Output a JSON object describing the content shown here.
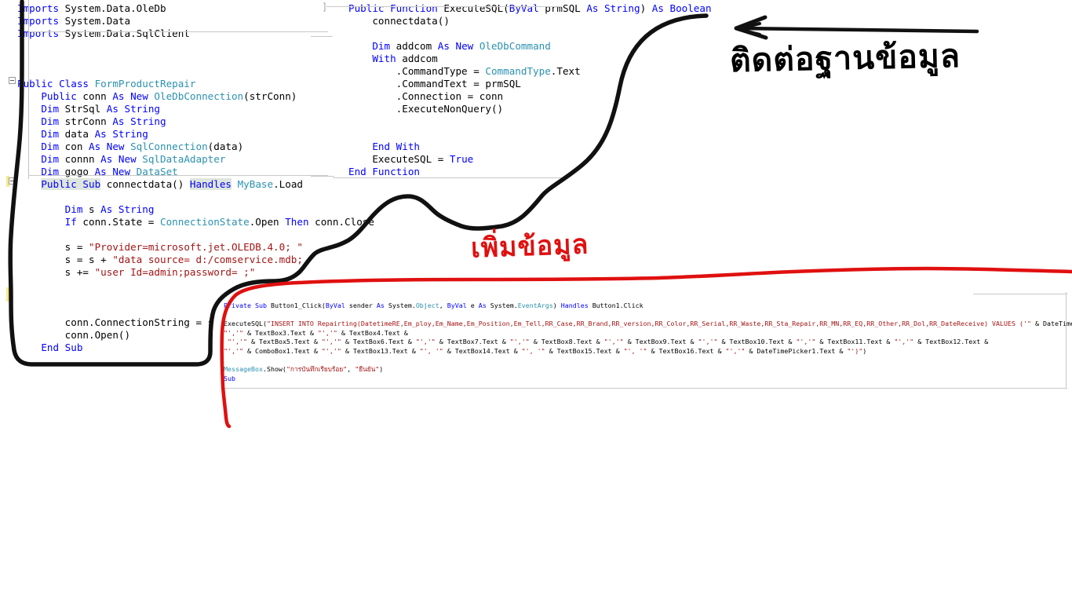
{
  "app": {
    "kind": "vb-net-code-editor-screenshot",
    "colors": {
      "keyword": "#0000FF",
      "type": "#2B91AF",
      "string": "#A31515",
      "plain": "#000000",
      "selection": "#DFE6DD",
      "black_ink": "#000000",
      "red_ink": "#E01010",
      "background": "#FFFFFF",
      "change_bar": "#F7E98A"
    }
  },
  "panes": {
    "top_left": {
      "name": "imports-and-class-declaration-pane",
      "lines": [
        [
          {
            "t": "Imports ",
            "c": "kw"
          },
          {
            "t": "System.Data.OleDb",
            "c": "pl"
          }
        ],
        [
          {
            "t": "Imports ",
            "c": "kw"
          },
          {
            "t": "System.Data",
            "c": "pl"
          }
        ],
        [
          {
            "t": "Imports ",
            "c": "kw"
          },
          {
            "t": "System.Data.SqlClient",
            "c": "pl"
          }
        ],
        [],
        [],
        [],
        [
          {
            "t": "Public Class ",
            "c": "kw"
          },
          {
            "t": "FormProductRepair",
            "c": "ty"
          }
        ],
        [
          {
            "t": "    Public ",
            "c": "kw"
          },
          {
            "t": "conn ",
            "c": "pl"
          },
          {
            "t": "As New ",
            "c": "kw"
          },
          {
            "t": "OleDbConnection",
            "c": "ty"
          },
          {
            "t": "(strConn)",
            "c": "pl"
          }
        ],
        [
          {
            "t": "    Dim ",
            "c": "kw"
          },
          {
            "t": "StrSql ",
            "c": "pl"
          },
          {
            "t": "As String",
            "c": "kw"
          }
        ],
        [
          {
            "t": "    Dim ",
            "c": "kw"
          },
          {
            "t": "strConn ",
            "c": "pl"
          },
          {
            "t": "As String",
            "c": "kw"
          }
        ],
        [
          {
            "t": "    Dim ",
            "c": "kw"
          },
          {
            "t": "data ",
            "c": "pl"
          },
          {
            "t": "As String",
            "c": "kw"
          }
        ],
        [
          {
            "t": "    Dim ",
            "c": "kw"
          },
          {
            "t": "con ",
            "c": "pl"
          },
          {
            "t": "As New ",
            "c": "kw"
          },
          {
            "t": "SqlConnection",
            "c": "ty"
          },
          {
            "t": "(data)",
            "c": "pl"
          }
        ],
        [
          {
            "t": "    Dim ",
            "c": "kw"
          },
          {
            "t": "connn ",
            "c": "pl"
          },
          {
            "t": "As New ",
            "c": "kw"
          },
          {
            "t": "SqlDataAdapter",
            "c": "ty"
          }
        ],
        [
          {
            "t": "    Dim ",
            "c": "kw"
          },
          {
            "t": "gogo ",
            "c": "pl"
          },
          {
            "t": "As New ",
            "c": "kw"
          },
          {
            "t": "DataSet",
            "c": "ty"
          }
        ],
        [
          {
            "t": "    ",
            "c": "pl"
          },
          {
            "t": "Public Sub",
            "c": "kw sel"
          },
          {
            "t": " connectdata() ",
            "c": "pl"
          },
          {
            "t": "Handles",
            "c": "kw sel"
          },
          {
            "t": " ",
            "c": "pl"
          },
          {
            "t": "MyBase",
            "c": "ty"
          },
          {
            "t": ".Load",
            "c": "pl"
          }
        ],
        [],
        [
          {
            "t": "        Dim ",
            "c": "kw"
          },
          {
            "t": "s ",
            "c": "pl"
          },
          {
            "t": "As String",
            "c": "kw"
          }
        ],
        [
          {
            "t": "        If ",
            "c": "kw"
          },
          {
            "t": "conn.State = ",
            "c": "pl"
          },
          {
            "t": "ConnectionState",
            "c": "ty"
          },
          {
            "t": ".Open ",
            "c": "pl"
          },
          {
            "t": "Then",
            "c": "kw"
          },
          {
            "t": " conn.Close",
            "c": "pl"
          }
        ],
        [],
        [
          {
            "t": "        s = ",
            "c": "pl"
          },
          {
            "t": "\"Provider=microsoft.jet.OLEDB.4.0; \"",
            "c": "str"
          }
        ],
        [
          {
            "t": "        s = s + ",
            "c": "pl"
          },
          {
            "t": "\"data source= d:/comservice.mdb; \"",
            "c": "str"
          }
        ],
        [
          {
            "t": "        s += ",
            "c": "pl"
          },
          {
            "t": "\"user Id=admin;password= ;\"",
            "c": "str"
          }
        ],
        [],
        [],
        [],
        [
          {
            "t": "        conn.ConnectionString = s",
            "c": "pl"
          }
        ],
        [
          {
            "t": "        conn.Open()",
            "c": "pl"
          }
        ],
        [
          {
            "t": "    End Sub",
            "c": "kw"
          }
        ]
      ]
    },
    "top_right": {
      "name": "executesql-function-pane",
      "lines": [
        [
          {
            "t": "Public Function ",
            "c": "kw"
          },
          {
            "t": "ExecuteSQL(",
            "c": "pl"
          },
          {
            "t": "ByVal ",
            "c": "kw"
          },
          {
            "t": "prmSQL ",
            "c": "pl"
          },
          {
            "t": "As String",
            "c": "kw"
          },
          {
            "t": ") ",
            "c": "pl"
          },
          {
            "t": "As Boolean",
            "c": "kw"
          }
        ],
        [
          {
            "t": "    connectdata()",
            "c": "pl"
          }
        ],
        [],
        [
          {
            "t": "    Dim ",
            "c": "kw"
          },
          {
            "t": "addcom ",
            "c": "pl"
          },
          {
            "t": "As New ",
            "c": "kw"
          },
          {
            "t": "OleDbCommand",
            "c": "ty"
          }
        ],
        [
          {
            "t": "    With ",
            "c": "kw"
          },
          {
            "t": "addcom",
            "c": "pl"
          }
        ],
        [
          {
            "t": "        .CommandType = ",
            "c": "pl"
          },
          {
            "t": "CommandType",
            "c": "ty"
          },
          {
            "t": ".Text",
            "c": "pl"
          }
        ],
        [
          {
            "t": "        .CommandText = prmSQL",
            "c": "pl"
          }
        ],
        [
          {
            "t": "        .Connection = conn",
            "c": "pl"
          }
        ],
        [
          {
            "t": "        .ExecuteNonQuery()",
            "c": "pl"
          }
        ],
        [],
        [],
        [
          {
            "t": "    End With",
            "c": "kw"
          }
        ],
        [
          {
            "t": "    ExecuteSQL = ",
            "c": "pl"
          },
          {
            "t": "True",
            "c": "kw"
          }
        ],
        [
          {
            "t": "End Function",
            "c": "kw"
          }
        ]
      ]
    },
    "bottom": {
      "name": "button1-click-handler-pane",
      "lines": [
        [
          {
            "t": "Private Sub ",
            "c": "kw"
          },
          {
            "t": "Button1_Click(",
            "c": "pl"
          },
          {
            "t": "ByVal ",
            "c": "kw"
          },
          {
            "t": "sender ",
            "c": "pl"
          },
          {
            "t": "As ",
            "c": "kw"
          },
          {
            "t": "System.",
            "c": "pl"
          },
          {
            "t": "Object",
            "c": "ty"
          },
          {
            "t": ", ",
            "c": "pl"
          },
          {
            "t": "ByVal ",
            "c": "kw"
          },
          {
            "t": "e ",
            "c": "pl"
          },
          {
            "t": "As ",
            "c": "kw"
          },
          {
            "t": "System.",
            "c": "pl"
          },
          {
            "t": "EventArgs",
            "c": "ty"
          },
          {
            "t": ") ",
            "c": "pl"
          },
          {
            "t": "Handles ",
            "c": "kw"
          },
          {
            "t": "Button1.Click",
            "c": "pl"
          }
        ],
        [],
        [
          {
            "t": "ExecuteSQL(",
            "c": "pl"
          },
          {
            "t": "\"INSERT INTO Repairting(DatetimeRE,Em_ploy,Em_Name,Em_Position,Em_Tell,RR_Case,RR_Brand,RR_version,RR_Color,RR_Serial,RR_Waste,RR_Sta_Repair,RR_MN,RR_EQ,RR_Other,RR_Dol,RR_DateReceive) VALUES ('\"",
            "c": "str"
          },
          {
            "t": " & DateTimePi",
            "c": "pl"
          }
        ],
        [
          {
            "t": "\"','\"",
            "c": "str"
          },
          {
            "t": " & TextBox3.Text & ",
            "c": "pl"
          },
          {
            "t": "\"','\"",
            "c": "str"
          },
          {
            "t": " & TextBox4.Text &",
            "c": "pl"
          }
        ],
        [
          {
            "t": " \"','\"",
            "c": "str"
          },
          {
            "t": " & TextBox5.Text & ",
            "c": "pl"
          },
          {
            "t": "\"','\"",
            "c": "str"
          },
          {
            "t": " & TextBox6.Text & ",
            "c": "pl"
          },
          {
            "t": "\"','\"",
            "c": "str"
          },
          {
            "t": " & TextBox7.Text & ",
            "c": "pl"
          },
          {
            "t": "\"','\"",
            "c": "str"
          },
          {
            "t": " & TextBox8.Text & ",
            "c": "pl"
          },
          {
            "t": "\"','\"",
            "c": "str"
          },
          {
            "t": " & TextBox9.Text & ",
            "c": "pl"
          },
          {
            "t": "\"','\"",
            "c": "str"
          },
          {
            "t": " & TextBox10.Text & ",
            "c": "pl"
          },
          {
            "t": "\"','\"",
            "c": "str"
          },
          {
            "t": " & TextBox11.Text & ",
            "c": "pl"
          },
          {
            "t": "\"','\"",
            "c": "str"
          },
          {
            "t": " & TextBox12.Text &",
            "c": "pl"
          }
        ],
        [
          {
            "t": "\"','\"",
            "c": "str"
          },
          {
            "t": " & ComboBox1.Text & ",
            "c": "pl"
          },
          {
            "t": "\"','\"",
            "c": "str"
          },
          {
            "t": " & TextBox13.Text & ",
            "c": "pl"
          },
          {
            "t": "\"', '\"",
            "c": "str"
          },
          {
            "t": " & TextBox14.Text & ",
            "c": "pl"
          },
          {
            "t": "\"', '\"",
            "c": "str"
          },
          {
            "t": " & TextBox15.Text & ",
            "c": "pl"
          },
          {
            "t": "\"', '\"",
            "c": "str"
          },
          {
            "t": " & TextBox16.Text & ",
            "c": "pl"
          },
          {
            "t": "\"','\"",
            "c": "str"
          },
          {
            "t": " & DateTimePicker1.Text & ",
            "c": "pl"
          },
          {
            "t": "\"')\"",
            "c": "str"
          },
          {
            "t": ")",
            "c": "pl"
          }
        ],
        [],
        [
          {
            "t": "MessageBox",
            "c": "ty"
          },
          {
            "t": ".Show(",
            "c": "pl"
          },
          {
            "t": "\"การบันทึกเรียบร้อย\"",
            "c": "str"
          },
          {
            "t": ", ",
            "c": "pl"
          },
          {
            "t": "\"ยืนยัน\"",
            "c": "str"
          },
          {
            "t": ")",
            "c": "pl"
          }
        ],
        [
          {
            "t": "Sub",
            "c": "kw"
          }
        ]
      ]
    }
  },
  "annotations": [
    {
      "id": "black-annotation",
      "name": "handwritten-annotation-connect-database",
      "text": "ติดต่อฐานข้อมูล",
      "translation": "connect to database",
      "color": "#000000",
      "has_arrow": true,
      "arrow_direction": "left"
    },
    {
      "id": "red-annotation",
      "name": "handwritten-annotation-add-data",
      "text": "เพิ่มข้อมูล",
      "translation": "add data",
      "color": "#E01010",
      "has_arrow": false
    }
  ]
}
